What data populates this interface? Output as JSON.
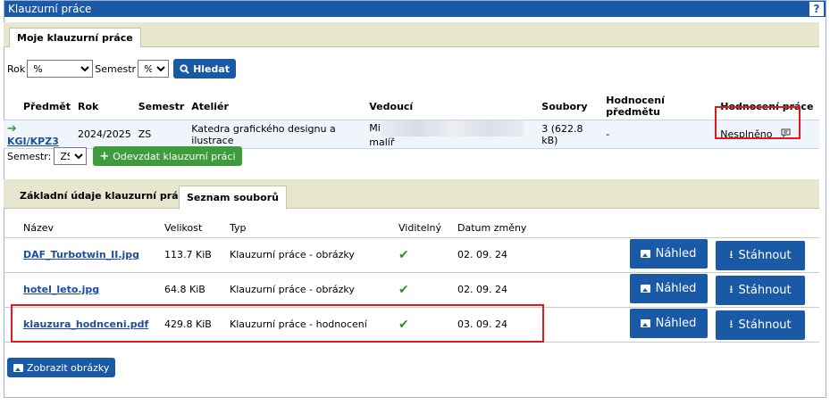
{
  "window": {
    "title": "Klauzurní práce",
    "help": "?"
  },
  "top_tabs": [
    "Moje klauzurní práce"
  ],
  "filters": {
    "rok_label": "Rok",
    "rok_value": "%",
    "semestr_label": "Semestr",
    "semestr_value": "%",
    "search_label": "Hledat"
  },
  "works_table": {
    "headers": [
      "Předmět",
      "Rok",
      "Semestr",
      "Ateliér",
      "Vedoucí",
      "Soubory",
      "Hodnocení předmětu",
      "Hodnocení práce"
    ],
    "row": {
      "subject": "KGI/KPZ3",
      "year": "2024/2025",
      "semester": "ZS",
      "atelier": "Katedra grafického designu a ilustrace",
      "leader_prefix": "Mi",
      "leader_suffix": "malíř",
      "files": "3 (622.8 kB)",
      "subject_rating": "-",
      "work_rating": "Nesplněno"
    }
  },
  "submit": {
    "semestr_label": "Semestr:",
    "semestr_value": "ZS",
    "button_label": "Odevzdat klauzurní práci"
  },
  "detail_tabs": [
    "Základní údaje klauzurní práce",
    "Seznam souborů"
  ],
  "files_table": {
    "headers": [
      "Název",
      "Velikost",
      "Typ",
      "Viditelný",
      "Datum změny"
    ],
    "rows": [
      {
        "name": "DAF_Turbotwin_II.jpg",
        "size": "113.7 KiB",
        "type": "Klauzurní práce - obrázky",
        "date": "02. 09. 24"
      },
      {
        "name": "hotel_leto.jpg",
        "size": "64.8 KiB",
        "type": "Klauzurní práce - obrázky",
        "date": "02. 09. 24"
      },
      {
        "name": "klauzura_hodnceni.pdf",
        "size": "429.8 KiB",
        "type": "Klauzurní práce - hodnocení",
        "date": "03. 09. 24"
      }
    ],
    "preview_label": "Náhled",
    "download_label": "Stáhnout"
  },
  "show_images_label": "Zobrazit obrázky"
}
